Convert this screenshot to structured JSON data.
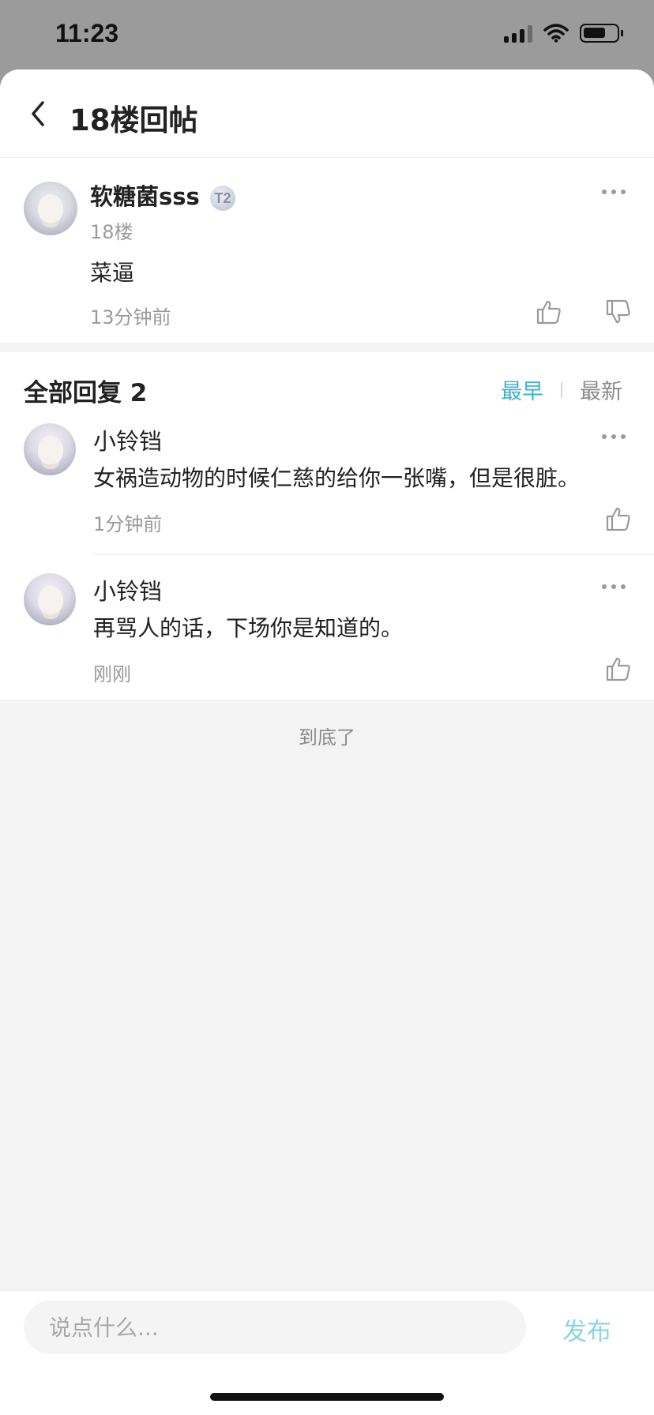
{
  "status_bar": {
    "time": "11:23"
  },
  "header": {
    "title": "18楼回帖"
  },
  "post": {
    "author": "软糖菌sss",
    "level_badge": "T2",
    "floor": "18楼",
    "content": "菜逼",
    "time": "13分钟前"
  },
  "replies": {
    "title": "全部回复 2",
    "sort": {
      "earliest": "最早",
      "latest": "最新",
      "active": "最早"
    },
    "items": [
      {
        "author": "小铃铛",
        "content": "女祸造动物的时候仁慈的给你一张嘴，但是很脏。",
        "time": "1分钟前"
      },
      {
        "author": "小铃铛",
        "content": "再骂人的话，下场你是知道的。",
        "time": "刚刚"
      }
    ]
  },
  "end_text": "到底了",
  "composer": {
    "placeholder": "说点什么...",
    "publish_label": "发布"
  },
  "colors": {
    "accent": "#3fb1c9",
    "publish": "#8fd3e3",
    "muted": "#9a9a9a"
  },
  "icons": [
    "back-icon",
    "more-icon",
    "thumbs-up-icon",
    "thumbs-down-icon",
    "level-badge-icon"
  ]
}
